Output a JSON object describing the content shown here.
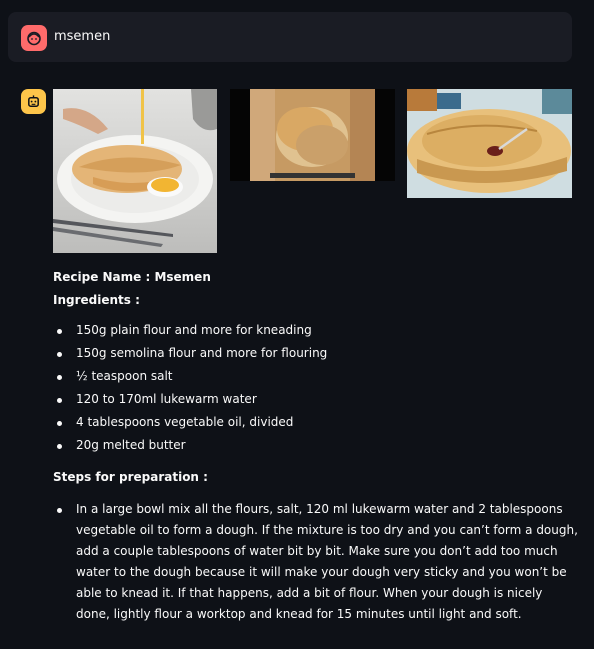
{
  "user_message": {
    "text": "msemen",
    "avatar_icon": "face-icon",
    "avatar_color": "#ff6b6b"
  },
  "assistant": {
    "avatar_icon": "robot-icon",
    "avatar_color": "#fdc54a"
  },
  "recipe": {
    "name_label": "Recipe Name : Msemen",
    "ingredients_label": "Ingredients :",
    "ingredients": [
      "150g plain flour and more for kneading",
      "150g semolina flour and more for flouring",
      "½ teaspoon salt",
      "120 to 170ml lukewarm water",
      "4 tablespoons vegetable oil, divided",
      "20g melted butter"
    ],
    "steps_label": "Steps for preparation :",
    "steps": [
      "In a large bowl mix all the flours, salt, 120 ml lukewarm water and 2 tablespoons vegetable oil to form a dough. If the mixture is too dry and you can’t form a dough, add a couple tablespoons of water bit by bit. Make sure you don’t add too much water to the dough because it will make your dough very sticky and you won’t be able to knead it. If that happens, add a bit of flour. When your dough is nicely done, lightly flour a worktop and knead for 15 minutes until light and soft."
    ]
  },
  "images": [
    {
      "name": "msemen-plate-with-honey-photo"
    },
    {
      "name": "msemen-stack-photo"
    },
    {
      "name": "msemen-platter-with-tea-photo"
    }
  ]
}
